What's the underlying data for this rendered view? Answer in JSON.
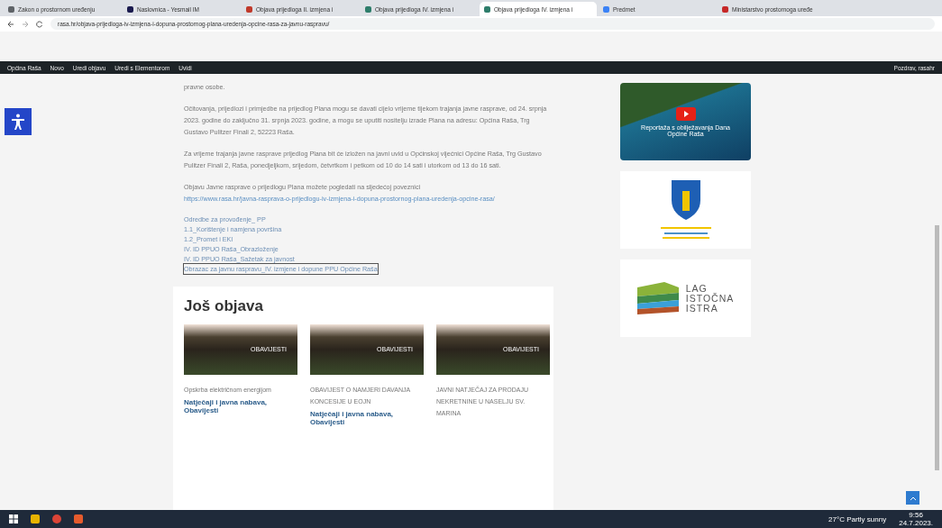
{
  "browser": {
    "tabs": [
      {
        "label": "Zakon o prostornom uređenju",
        "selected": false,
        "color": "#5f6368"
      },
      {
        "label": "Naslovnica - Yesmail IM",
        "selected": false,
        "color": "#1a1a4e"
      },
      {
        "label": "Objava prijedloga II. izmjena i",
        "selected": false,
        "color": "#c0392b"
      },
      {
        "label": "Objava prijedloga IV. izmjena i",
        "selected": false,
        "color": "#2e7d6b"
      },
      {
        "label": "Objava prijedloga IV. izmjena i",
        "selected": true,
        "color": "#2e7d6b"
      },
      {
        "label": "Predmet",
        "selected": false,
        "color": "#3b82f6"
      },
      {
        "label": "Ministarstvo prostornoga uređe",
        "selected": false,
        "color": "#c62828"
      }
    ],
    "address": "rasa.hr/objava-prijedloga-iv-izmjena-i-dopuna-prostornog-plana-uredenja-opcine-rasa-za-javnu-raspravu/"
  },
  "admin_bar": {
    "items": [
      "Općina Raša",
      "Novo",
      "Uredi objavu",
      "Uredi s Elementorom",
      "Uvidi"
    ],
    "greeting": "Pozdrav, rasahr"
  },
  "article": {
    "paragraphs": [
      "pravne osobe.",
      "Očitovanja, prijedlozi i primjedbe na prijedlog Plana mogu se davati cijelo vrijeme tijekom trajanja javne rasprave, od 24. srpnja 2023. godine do zaključno 31. srpnja 2023. godine, a mogu se uputiti nositelju izrade Plana na adresu: Općina Raša, Trg Gustavo Pulitzer Finali 2, 52223 Raša.",
      "Za vrijeme trajanja javne rasprave prijedlog Plana bit će izložen na javni uvid u Općinskoj vijećnici Općine Raša, Trg Gustavo Pulitzer Finali 2, Raša, ponedjeljkom, srijedom, četvrtkom i petkom od 10 do 14 sati i utorkom od 13 do 16 sati."
    ],
    "link_paragraph": {
      "text": "Objavu Javne rasprave o prijedlogu Plana možete pogledati na sljedećoj poveznici",
      "url": "https://www.rasa.hr/javna-rasprava-o-prijedlogu-iv-izmjena-i-dopuna-prostornog-plana-uredenja-opcine-rasa/"
    },
    "attachments": [
      {
        "label": "Odredbe za provođenje_ PP",
        "focused": false
      },
      {
        "label": "1.1_Korištenje i namjena površina",
        "focused": false
      },
      {
        "label": "1.2_Promet i EKI",
        "focused": false
      },
      {
        "label": "IV. ID PPUO Raša_Obrazloženje",
        "focused": false
      },
      {
        "label": "IV. ID PPUO Raša_Sažetak za javnost",
        "focused": false
      },
      {
        "label": "Obrazac za javnu raspravu_IV. izmjene i dopune PPU Općine Raša",
        "focused": true
      }
    ]
  },
  "more_posts": {
    "heading": "Još objava",
    "posts": [
      {
        "badge": "OBAVIJESTI",
        "title": "Opskrba električnom energijom",
        "categories": "Natječaji i javna nabava, Obavijesti"
      },
      {
        "badge": "OBAVIJESTI",
        "title": "OBAVIJEST O NAMJERI DAVANJA KONCESIJE U EOJN",
        "categories": "Natječaji i javna nabava, Obavijesti"
      },
      {
        "badge": "OBAVIJESTI",
        "title": "JAVNI NATJEČAJ ZA PRODAJU NEKRETNINE U NASELJU SV. MARINA"
      }
    ]
  },
  "sidebar": {
    "video_caption": "Reportaža s obilježavanja Dana Općine Raša",
    "lag_logo": [
      "LAG",
      "ISTOČNA",
      "ISTRA"
    ]
  },
  "taskbar": {
    "weather": "27°C Partly sunny",
    "time": "9:56",
    "date": "24.7.2023."
  }
}
